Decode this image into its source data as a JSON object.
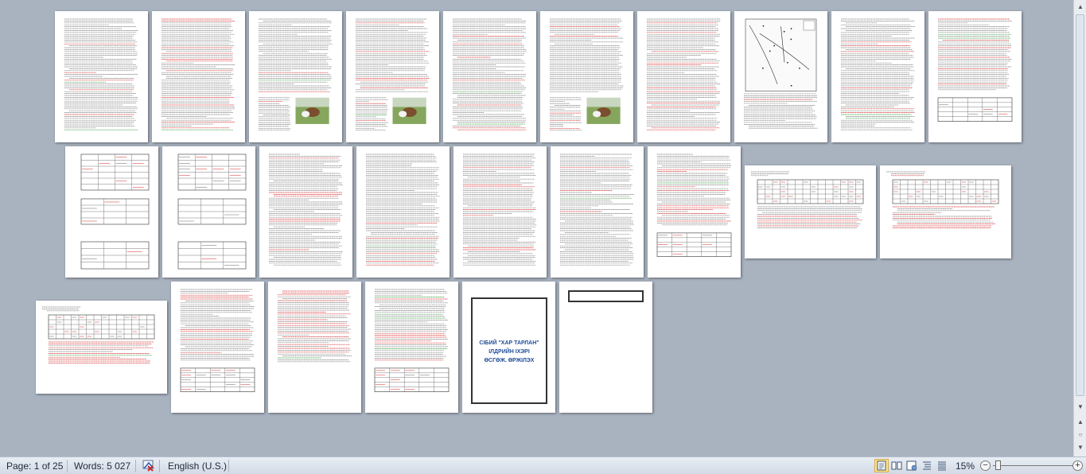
{
  "statusbar": {
    "page_label": "Page: 1 of 25",
    "words_label": "Words: 5 027",
    "language": "English (U.S.)",
    "zoom": "15%",
    "zoom_out": "−",
    "zoom_in": "+"
  },
  "scrollbar": {
    "up_arrow": "▲",
    "down_arrow": "▼",
    "prev_page": "▲",
    "browse": "○",
    "next_page": "▼"
  },
  "views": [
    {
      "name": "print-layout",
      "active": true
    },
    {
      "name": "full-screen-reading",
      "active": false
    },
    {
      "name": "web-layout",
      "active": false
    },
    {
      "name": "outline",
      "active": false
    },
    {
      "name": "draft",
      "active": false
    }
  ],
  "icons": {
    "proofing": "proofing-errors-icon",
    "image": "photo-icon",
    "map": "map-figure-icon",
    "table": "table-icon"
  },
  "pages": [
    {
      "kind": "text"
    },
    {
      "kind": "text"
    },
    {
      "kind": "text-image"
    },
    {
      "kind": "text-image"
    },
    {
      "kind": "text"
    },
    {
      "kind": "text-image"
    },
    {
      "kind": "text"
    },
    {
      "kind": "map"
    },
    {
      "kind": "text"
    },
    {
      "kind": "text-table"
    },
    {
      "kind": "tables"
    },
    {
      "kind": "tables"
    },
    {
      "kind": "text"
    },
    {
      "kind": "text"
    },
    {
      "kind": "text"
    },
    {
      "kind": "text"
    },
    {
      "kind": "text-table"
    },
    {
      "kind": "landscape-table"
    },
    {
      "kind": "landscape-table"
    },
    {
      "kind": "landscape-table"
    },
    {
      "kind": "text-table"
    },
    {
      "kind": "list"
    },
    {
      "kind": "text-table"
    },
    {
      "kind": "title"
    },
    {
      "kind": "title"
    }
  ],
  "title_page": {
    "line1": "СІБИЙ \"ХАР ТАРЛАН\"",
    "line2": "ІЛДРИЙН ІХЭРІ",
    "line3": "ӨСГӨЖ. ӨРЖІЛЭХ"
  },
  "colors": {
    "workspace": "#a9b3c0",
    "page": "#ffffff",
    "text_lines": "#7a7a7a",
    "spell_error": "#d42a2a",
    "grammar_error": "#2e9a3a",
    "active_view": "#fbe28c"
  }
}
